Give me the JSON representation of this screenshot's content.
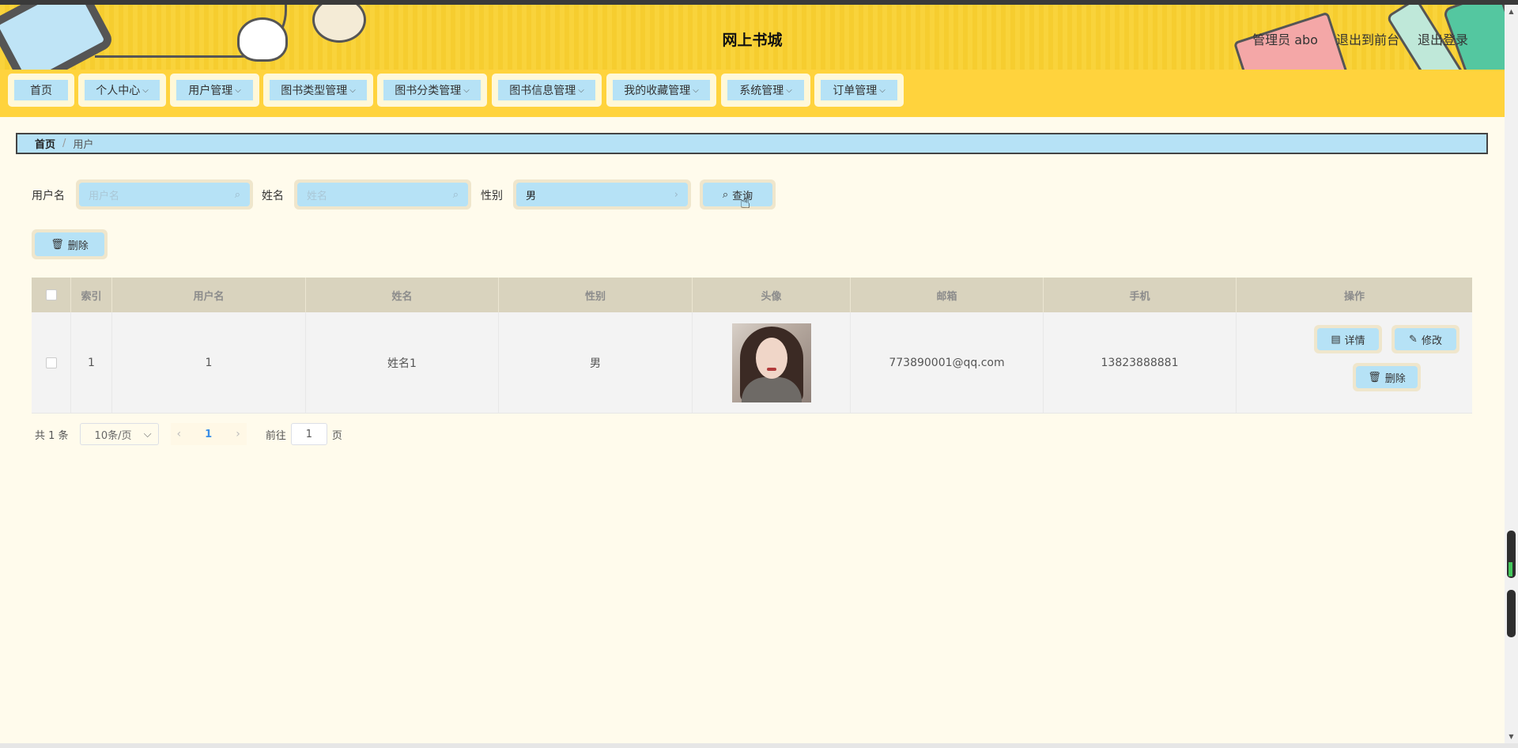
{
  "header": {
    "title": "网上书城",
    "user_label": "管理员 abo",
    "back_front": "退出到前台",
    "logout": "退出登录"
  },
  "nav": {
    "items": [
      {
        "label": "首页",
        "has_dropdown": false
      },
      {
        "label": "个人中心",
        "has_dropdown": true
      },
      {
        "label": "用户管理",
        "has_dropdown": true
      },
      {
        "label": "图书类型管理",
        "has_dropdown": true
      },
      {
        "label": "图书分类管理",
        "has_dropdown": true
      },
      {
        "label": "图书信息管理",
        "has_dropdown": true
      },
      {
        "label": "我的收藏管理",
        "has_dropdown": true
      },
      {
        "label": "系统管理",
        "has_dropdown": true
      },
      {
        "label": "订单管理",
        "has_dropdown": true
      }
    ]
  },
  "breadcrumb": {
    "home": "首页",
    "separator": "/",
    "current": "用户"
  },
  "search": {
    "username_label": "用户名",
    "username_placeholder": "用户名",
    "name_label": "姓名",
    "name_placeholder": "姓名",
    "gender_label": "性别",
    "gender_value": "男",
    "query_button": "查询"
  },
  "toolbar": {
    "delete_button": "删除"
  },
  "table": {
    "columns": [
      "索引",
      "用户名",
      "姓名",
      "性别",
      "头像",
      "邮箱",
      "手机",
      "操作"
    ],
    "rows": [
      {
        "index": "1",
        "username": "1",
        "name": "姓名1",
        "gender": "男",
        "email": "773890001@qq.com",
        "phone": "13823888881",
        "actions": {
          "detail": "详情",
          "edit": "修改",
          "delete": "删除"
        }
      }
    ]
  },
  "pagination": {
    "total_text": "共 1 条",
    "page_size": "10条/页",
    "current_page": "1",
    "goto_label": "前往",
    "goto_value": "1",
    "page_suffix": "页"
  },
  "colors": {
    "header_yellow": "#f9d33b",
    "nav_yellow": "#ffd33d",
    "button_blue": "#b6e2f6",
    "page_bg": "#fffbec",
    "table_header": "#d9d3be"
  }
}
